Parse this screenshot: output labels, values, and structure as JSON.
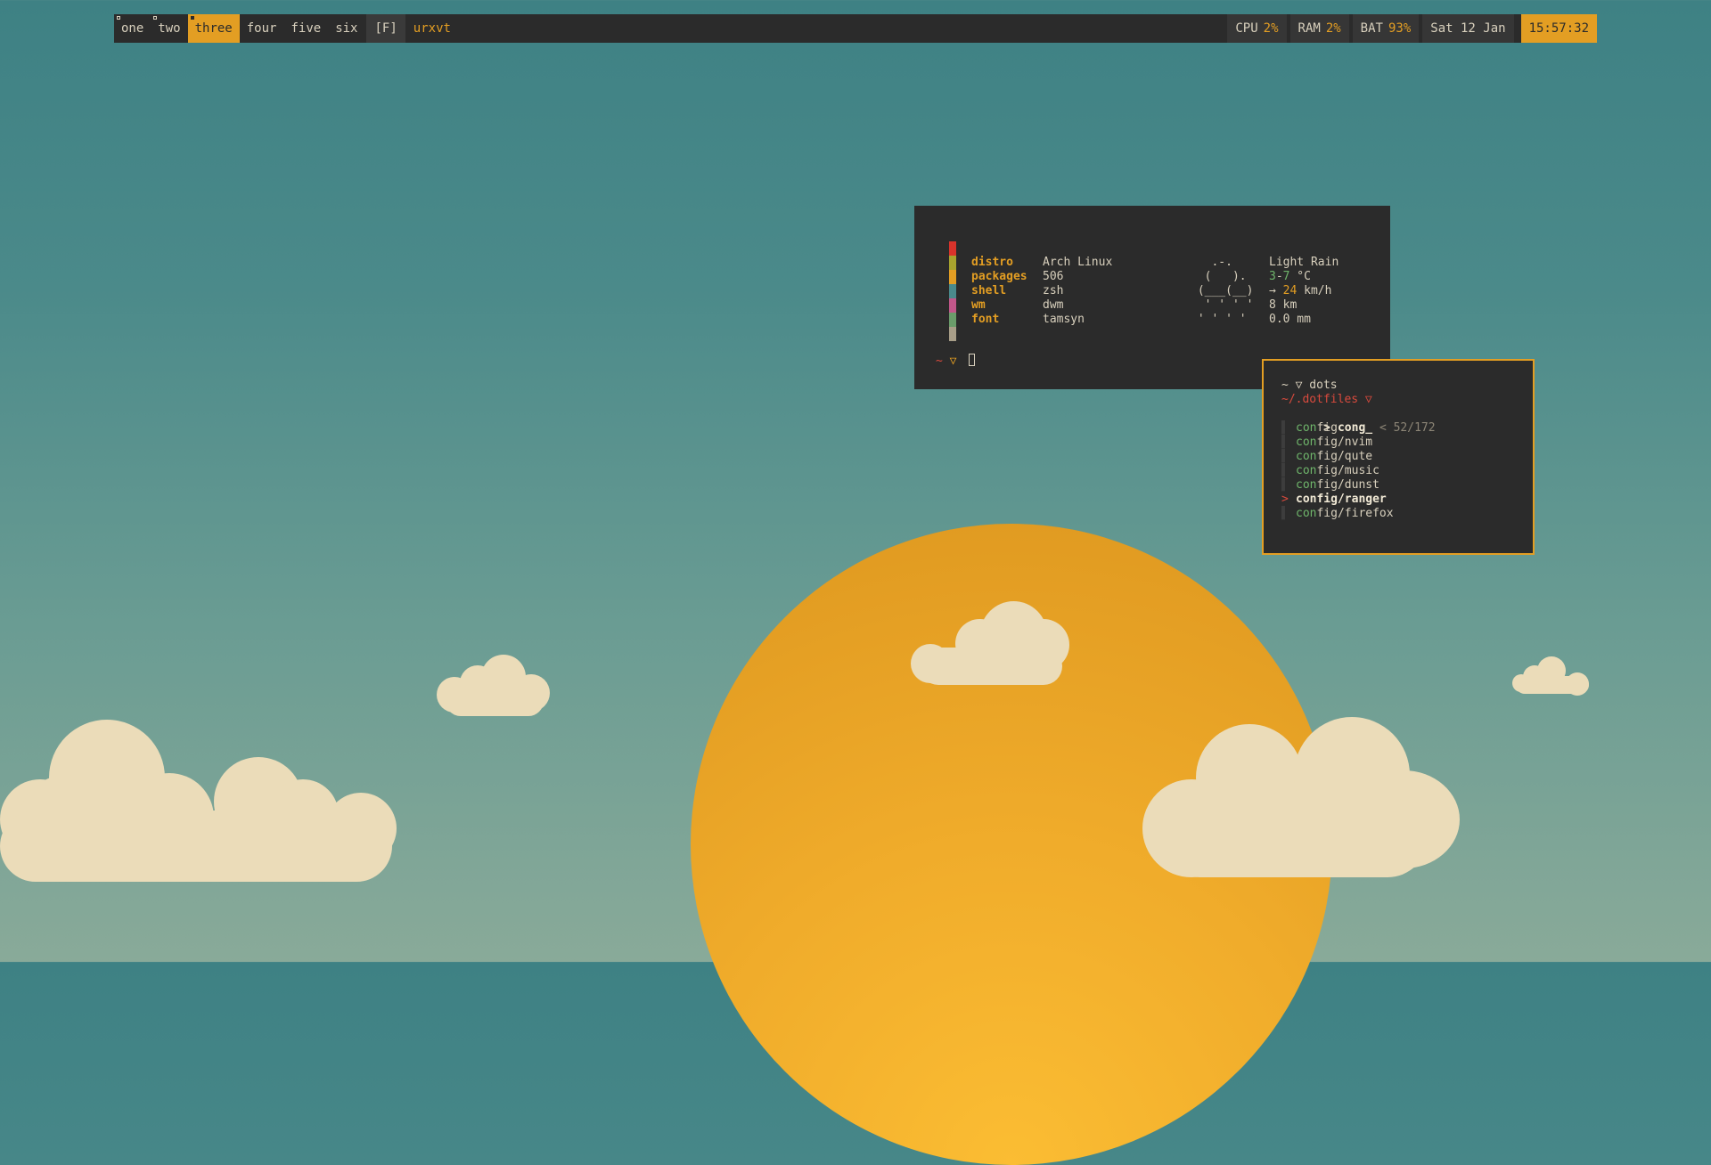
{
  "bar": {
    "workspaces": [
      "one",
      "two",
      "three",
      "four",
      "five",
      "six"
    ],
    "active_workspace": "three",
    "layout": "[F]",
    "window_title": "urxvt",
    "cpu_label": "CPU",
    "cpu_value": "2%",
    "ram_label": "RAM",
    "ram_value": "2%",
    "bat_label": "BAT",
    "bat_value": "93%",
    "date": "Sat 12 Jan",
    "time": "15:57:32"
  },
  "fetch": {
    "rows": [
      {
        "key": "distro",
        "value": "Arch Linux"
      },
      {
        "key": "packages",
        "value": "506"
      },
      {
        "key": "shell",
        "value": "zsh"
      },
      {
        "key": "wm",
        "value": "dwm"
      },
      {
        "key": "font",
        "value": "tamsyn"
      }
    ],
    "palette": [
      "#d9332b",
      "#a8a32e",
      "#e39e23",
      "#4a8a8c",
      "#c2578a",
      "#6a9c6a",
      "#a89e88"
    ],
    "weather_art": "   .-.\n  (   ).\n (___(__)\n  ' ' ' '\n ' ' ' '",
    "weather_condition": "Light Rain",
    "temp_low": "3",
    "temp_sep": "-",
    "temp_high": "7",
    "temp_unit": " °C",
    "wind_arrow": "→ ",
    "wind_speed": "24",
    "wind_unit": " km/h",
    "visibility": "8 km",
    "precipitation": "0.0 mm",
    "prompt_tilde": "~",
    "prompt_symbol": "▽"
  },
  "fzf": {
    "prompt_line": "~ ▽ dots",
    "dir_line": "~/.dotfiles ▽",
    "query": "cong_",
    "count": "< 52/172",
    "items": [
      {
        "prefix": "con",
        "rest": "fig"
      },
      {
        "prefix": "con",
        "rest": "fig/nvim"
      },
      {
        "prefix": "con",
        "rest": "fig/qute"
      },
      {
        "prefix": "con",
        "rest": "fig/music"
      },
      {
        "prefix": "con",
        "rest": "fig/dunst"
      },
      {
        "prefix": "con",
        "rest": "fig/ranger"
      },
      {
        "prefix": "con",
        "rest": "fig/firefox"
      }
    ],
    "selected_text": "config/ranger"
  },
  "colors": {
    "accent": "#e39e23",
    "bar_bg": "#2b2b2b",
    "sun": "#f0ac2b",
    "cloud": "#ebdcb9"
  }
}
